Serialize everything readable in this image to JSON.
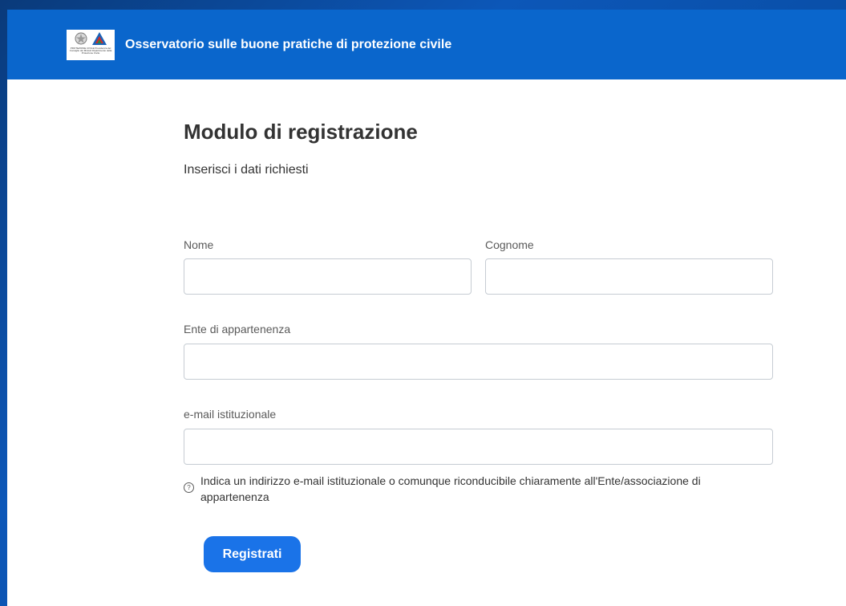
{
  "header": {
    "logo_text": "PROTEZIONE CIVILE Presidenza del Consiglio dei Ministri Dipartimento della Protezione Civile",
    "site_title": "Osservatorio sulle buone pratiche di protezione civile"
  },
  "form": {
    "title": "Modulo di registrazione",
    "subtitle": "Inserisci i dati richiesti",
    "fields": {
      "nome": {
        "label": "Nome",
        "value": ""
      },
      "cognome": {
        "label": "Cognome",
        "value": ""
      },
      "ente": {
        "label": "Ente di appartenenza",
        "value": ""
      },
      "email": {
        "label": "e-mail istituzionale",
        "value": ""
      }
    },
    "help_text": "Indica un indirizzo e-mail istituzionale o comunque riconducibile chiaramente all'Ente/associazione di appartenenza",
    "submit_label": "Registrati"
  },
  "colors": {
    "header_bg": "#0a66cc",
    "button_bg": "#1a73e8",
    "backdrop": "#0c57b8"
  },
  "icons": {
    "help": "question-circle-icon",
    "logo": "protezione-civile-logo"
  }
}
